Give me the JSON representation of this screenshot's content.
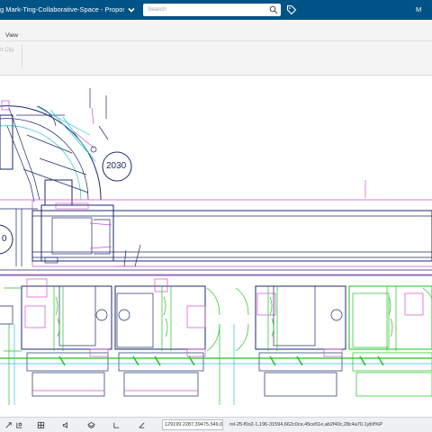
{
  "header": {
    "title": "g Mark-Ting-Collaborative-Space - Propos...",
    "search_placeholder": "Search",
    "user_initial": "M"
  },
  "ribbon": {
    "tab_label": "View",
    "command_label": "rt Clip"
  },
  "drawing": {
    "label_2030": "2030",
    "label_left": "0"
  },
  "statusbar": {
    "coordinates": "129199.2287,39475.549,0",
    "object_ref": "rel-25-f0o2-1,196-31594,662c0ce,45ce51e,ab2f40c,28c4a70.1yb\\f%P"
  },
  "colors": {
    "header_bg": "#005386",
    "ribbon_bg": "#f4f4f4",
    "drawing_magenta": "#d14fd1",
    "drawing_green": "#22c022",
    "drawing_cyan": "#27c2d6",
    "drawing_navy": "#1b2a6b"
  }
}
